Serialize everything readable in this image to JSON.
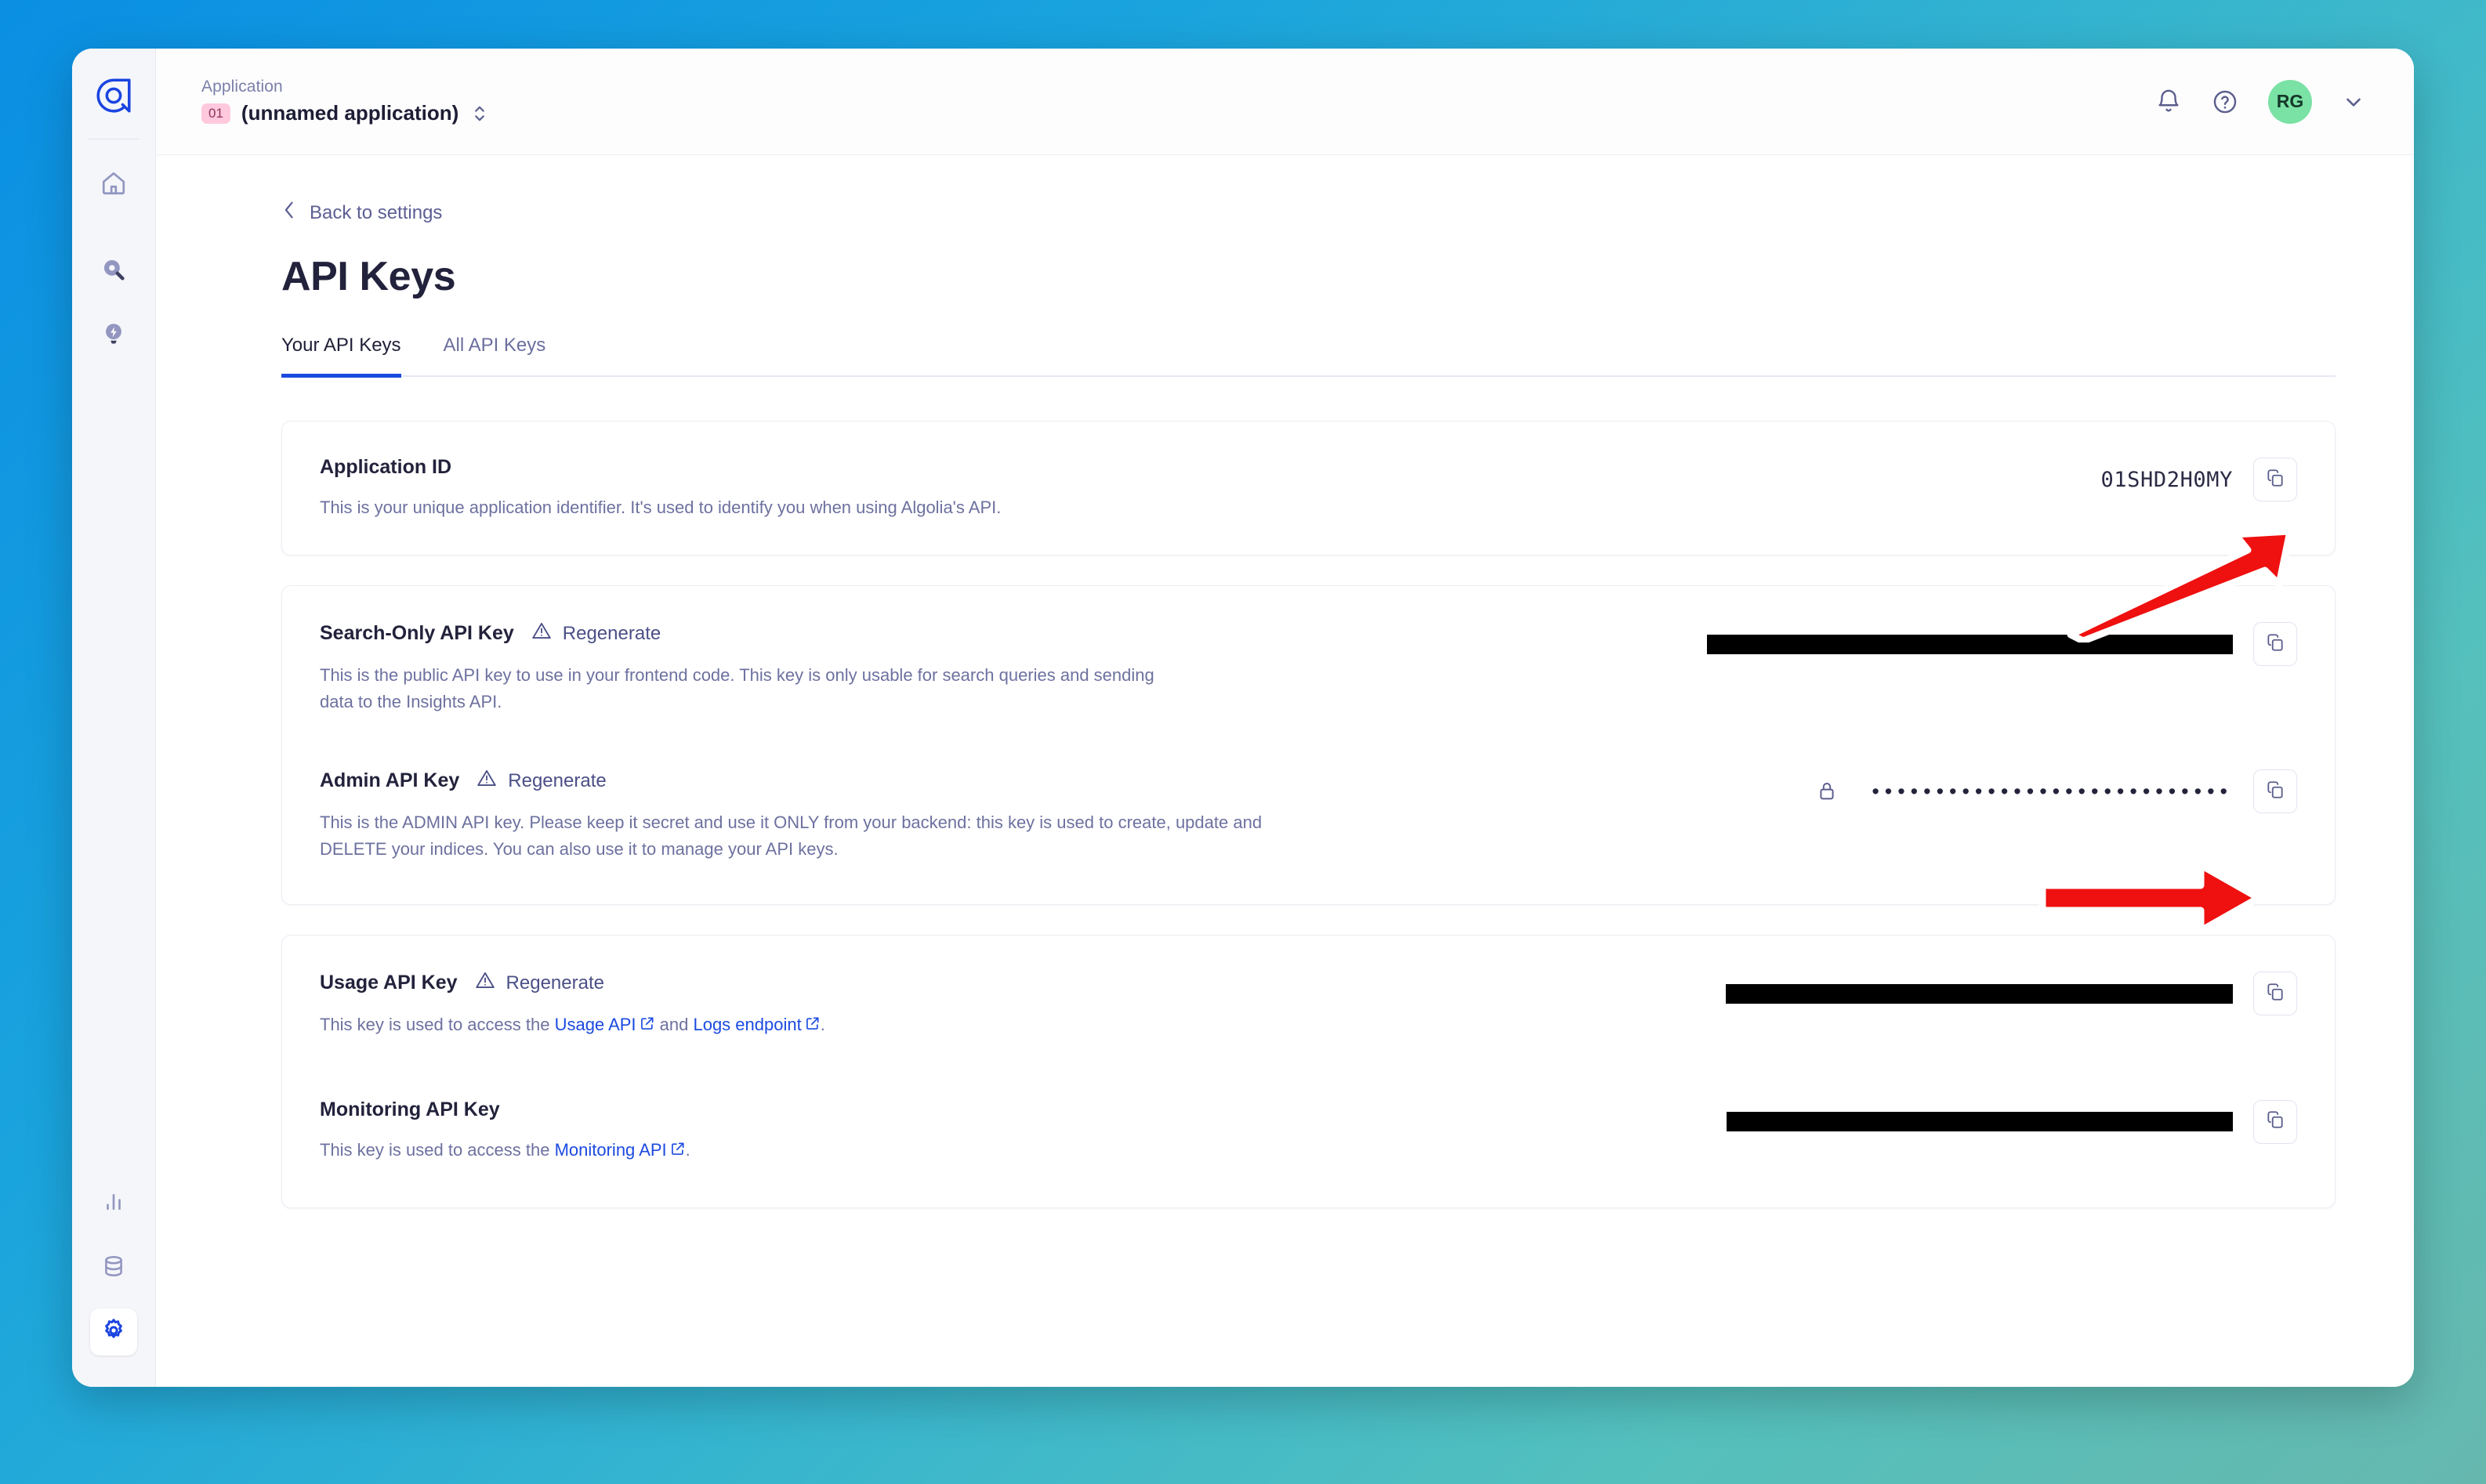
{
  "window": {
    "background_gradient_from": "#0a8fe3",
    "background_gradient_to": "#66b8ae"
  },
  "sidebar": {
    "logo_name": "algolia-logo-icon",
    "items": [
      {
        "name": "home-icon",
        "label": "Home"
      },
      {
        "name": "search-icon",
        "label": "Search"
      },
      {
        "name": "lightning-bulb-icon",
        "label": "Recommend"
      }
    ],
    "bottom_items": [
      {
        "name": "analytics-bars-icon",
        "label": "Analytics",
        "active": false
      },
      {
        "name": "database-icon",
        "label": "Data sources",
        "active": false
      },
      {
        "name": "gear-icon",
        "label": "Settings",
        "active": true
      }
    ],
    "active_accent": "#1b4ae0"
  },
  "topbar": {
    "application_label": "Application",
    "application_badge": "01",
    "application_name": "(unnamed application)",
    "switcher_icon": "chevron-up-down-icon",
    "notifications_icon": "bell-icon",
    "help_icon": "question-circle-icon",
    "avatar_initials": "RG",
    "avatar_color": "#7ae2a4",
    "account_chevron_icon": "chevron-down-icon"
  },
  "page": {
    "back_link": "Back to settings",
    "back_icon": "chevron-left-icon",
    "title": "API Keys",
    "tabs": [
      {
        "label": "Your API Keys",
        "active": true
      },
      {
        "label": "All API Keys",
        "active": false
      }
    ]
  },
  "cards": [
    {
      "id": "application-id-card",
      "rows": [
        {
          "id": "application-id",
          "title": "Application ID",
          "regenerate": null,
          "description": "This is your unique application identifier. It's used to identify you when using Algolia's API.",
          "value_type": "text",
          "value": "01SHD2H0MY",
          "locked": false,
          "copy_icon": "copy-icon"
        }
      ]
    },
    {
      "id": "search-admin-keys-card",
      "rows": [
        {
          "id": "search-only-api-key",
          "title": "Search-Only API Key",
          "regenerate": "Regenerate",
          "regenerate_icon": "warning-triangle-icon",
          "description": "This is the public API key to use in your frontend code. This key is only usable for search queries and sending data to the Insights API.",
          "value_type": "redacted",
          "value": "",
          "redacted_width": 671,
          "locked": false,
          "copy_icon": "copy-icon"
        },
        {
          "id": "admin-api-key",
          "title": "Admin API Key",
          "regenerate": "Regenerate",
          "regenerate_icon": "warning-triangle-icon",
          "description": "This is the ADMIN API key. Please keep it secret and use it ONLY from your backend: this key is used to create, update and DELETE your indices. You can also use it to manage your API keys.",
          "value_type": "dots",
          "value": "••••••••••••••••••••••••••••",
          "locked": true,
          "lock_icon": "lock-icon",
          "copy_icon": "copy-icon"
        }
      ]
    },
    {
      "id": "usage-monitoring-keys-card",
      "rows": [
        {
          "id": "usage-api-key",
          "title": "Usage API Key",
          "regenerate": "Regenerate",
          "regenerate_icon": "warning-triangle-icon",
          "description_parts": [
            {
              "type": "text",
              "text": "This key is used to access the "
            },
            {
              "type": "link",
              "text": "Usage API",
              "icon": "external-link-icon"
            },
            {
              "type": "text",
              "text": " and "
            },
            {
              "type": "link",
              "text": "Logs endpoint",
              "icon": "external-link-icon"
            },
            {
              "type": "text",
              "text": "."
            }
          ],
          "value_type": "redacted",
          "value": "",
          "redacted_width": 647,
          "locked": false,
          "copy_icon": "copy-icon"
        },
        {
          "id": "monitoring-api-key",
          "title": "Monitoring API Key",
          "regenerate": null,
          "description_parts": [
            {
              "type": "text",
              "text": "This key is used to access the "
            },
            {
              "type": "link",
              "text": "Monitoring API",
              "icon": "external-link-icon"
            },
            {
              "type": "text",
              "text": "."
            }
          ],
          "value_type": "redacted",
          "value": "",
          "redacted_width": 646,
          "locked": false,
          "copy_icon": "copy-icon"
        }
      ]
    }
  ],
  "annotations": [
    {
      "id": "arrow-to-application-id-copy",
      "type": "red-arrow",
      "direction": "up-right",
      "points_at": "application-id copy button"
    },
    {
      "id": "arrow-to-admin-key-copy",
      "type": "red-arrow",
      "direction": "right",
      "points_at": "admin-api-key copy button"
    }
  ]
}
